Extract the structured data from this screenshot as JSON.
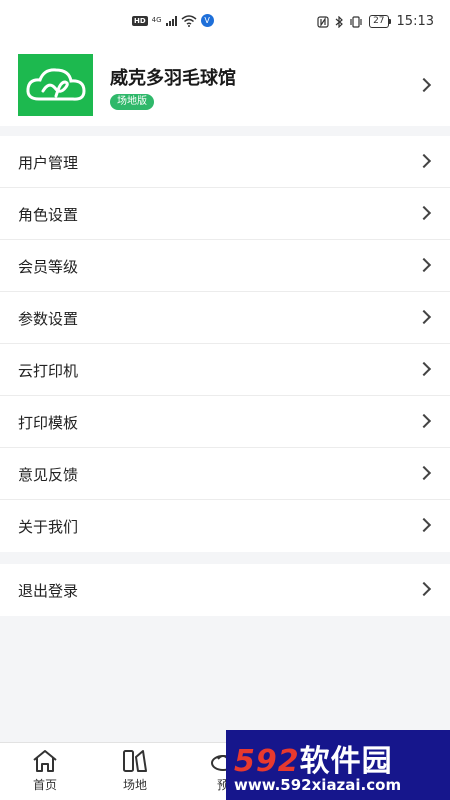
{
  "status_bar": {
    "network_badge": "HD",
    "network_type": "4G",
    "vpn_label": "V",
    "battery": "27",
    "time": "15:13"
  },
  "profile": {
    "venue_name": "威克多羽毛球馆",
    "edition": "场地版"
  },
  "menu": {
    "items": [
      {
        "label": "用户管理"
      },
      {
        "label": "角色设置"
      },
      {
        "label": "会员等级"
      },
      {
        "label": "参数设置"
      },
      {
        "label": "云打印机"
      },
      {
        "label": "打印模板"
      },
      {
        "label": "意见反馈"
      },
      {
        "label": "关于我们"
      }
    ]
  },
  "logout": {
    "label": "退出登录"
  },
  "tabbar": {
    "tabs": [
      {
        "label": "首页",
        "icon": "home-icon"
      },
      {
        "label": "场地",
        "icon": "venue-icon"
      },
      {
        "label": "预",
        "icon": "booking-icon"
      }
    ]
  },
  "watermark": {
    "brand_digits": "592",
    "brand_text": "软件园",
    "url": "www.592xiazai.com"
  },
  "colors": {
    "brand_green": "#1db94f",
    "badge_green": "#2fb86a",
    "watermark_blue": "#16168c",
    "watermark_red": "#e8392e"
  }
}
